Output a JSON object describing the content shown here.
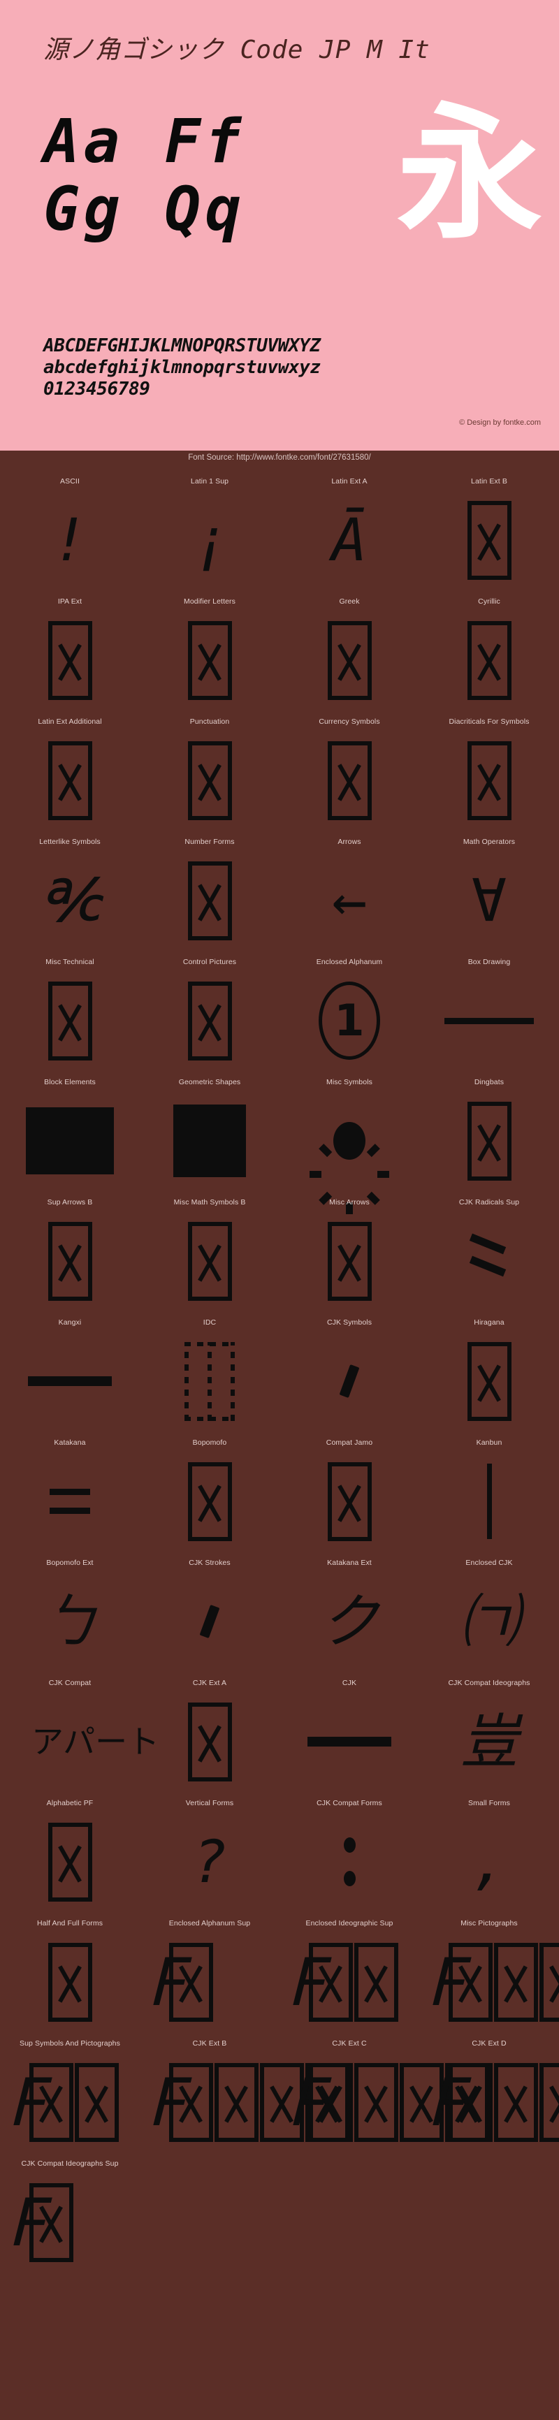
{
  "header": {
    "font_title": "源ノ角ゴシック Code JP M It",
    "sample_line_1": "Aa  Ff",
    "sample_line_2": "Gg  Qq",
    "cjk_hero": "永",
    "uppercase": "ABCDEFGHIJKLMNOPQRSTUVWXYZ",
    "lowercase": "abcdefghijklmnopqrstuvwxyz",
    "digits": "0123456789",
    "credit": "© Design by fontke.com",
    "bg_color": "#F7AEB8",
    "title_color": "#4A2420"
  },
  "source_bar": {
    "text": "Font Source: http://www.fontke.com/font/27631580/",
    "bg_color": "#5B2E27",
    "text_color": "#D9C3C0"
  },
  "grid": {
    "label_color": "#E3CFCC",
    "glyph_color": "#0D0D0D",
    "columns": 4,
    "blocks": [
      {
        "label": "ASCII",
        "glyph": "!",
        "kind": "char"
      },
      {
        "label": "Latin 1 Sup",
        "glyph": "¡",
        "kind": "char"
      },
      {
        "label": "Latin Ext A",
        "glyph": "Ā",
        "kind": "char"
      },
      {
        "label": "Latin Ext B",
        "glyph": "",
        "kind": "tofu"
      },
      {
        "label": "IPA Ext",
        "glyph": "",
        "kind": "tofu"
      },
      {
        "label": "Modifier Letters",
        "glyph": "",
        "kind": "tofu"
      },
      {
        "label": "Greek",
        "glyph": "",
        "kind": "tofu"
      },
      {
        "label": "Cyrillic",
        "glyph": "",
        "kind": "tofu"
      },
      {
        "label": "Latin Ext Additional",
        "glyph": "",
        "kind": "tofu"
      },
      {
        "label": "Punctuation",
        "glyph": "",
        "kind": "tofu"
      },
      {
        "label": "Currency Symbols",
        "glyph": "",
        "kind": "tofu"
      },
      {
        "label": "Diacriticals For Symbols",
        "glyph": "",
        "kind": "tofu"
      },
      {
        "label": "Letterlike Symbols",
        "glyph": "℀",
        "kind": "char"
      },
      {
        "label": "Number Forms",
        "glyph": "",
        "kind": "tofu"
      },
      {
        "label": "Arrows",
        "glyph": "←",
        "kind": "char"
      },
      {
        "label": "Math Operators",
        "glyph": "∀",
        "kind": "char"
      },
      {
        "label": "Misc Technical",
        "glyph": "",
        "kind": "tofu"
      },
      {
        "label": "Control Pictures",
        "glyph": "",
        "kind": "tofu"
      },
      {
        "label": "Enclosed Alphanum",
        "glyph": "1",
        "kind": "circled"
      },
      {
        "label": "Box Drawing",
        "glyph": "─",
        "kind": "bar-h"
      },
      {
        "label": "Block Elements",
        "glyph": "█",
        "kind": "block-wide"
      },
      {
        "label": "Geometric Shapes",
        "glyph": "■",
        "kind": "block-square"
      },
      {
        "label": "Misc Symbols",
        "glyph": "☀",
        "kind": "sun"
      },
      {
        "label": "Dingbats",
        "glyph": "",
        "kind": "tofu"
      },
      {
        "label": "Sup Arrows B",
        "glyph": "",
        "kind": "tofu"
      },
      {
        "label": "Misc Math Symbols B",
        "glyph": "",
        "kind": "tofu"
      },
      {
        "label": "Misc Arrows",
        "glyph": "",
        "kind": "tofu"
      },
      {
        "label": "CJK Radicals Sup",
        "glyph": "⺀",
        "kind": "two-strokes"
      },
      {
        "label": "Kangxi",
        "glyph": "⼀",
        "kind": "bar-h2"
      },
      {
        "label": "IDC",
        "glyph": "⿰",
        "kind": "tofu-dashed"
      },
      {
        "label": "CJK Symbols",
        "glyph": "、",
        "kind": "dot-stroke"
      },
      {
        "label": "Hiragana",
        "glyph": "",
        "kind": "tofu"
      },
      {
        "label": "Katakana",
        "glyph": "゠",
        "kind": "double-bar"
      },
      {
        "label": "Bopomofo",
        "glyph": "",
        "kind": "tofu"
      },
      {
        "label": "Compat Jamo",
        "glyph": "",
        "kind": "tofu"
      },
      {
        "label": "Kanbun",
        "glyph": "㆐",
        "kind": "bar-v"
      },
      {
        "label": "Bopomofo Ext",
        "glyph": "ㄅ",
        "kind": "char"
      },
      {
        "label": "CJK Strokes",
        "glyph": "㇐",
        "kind": "dot-stroke"
      },
      {
        "label": "Katakana Ext",
        "glyph": "ク",
        "kind": "char"
      },
      {
        "label": "Enclosed CJK",
        "glyph": "㈀",
        "kind": "char"
      },
      {
        "label": "CJK Compat",
        "glyph": "アパート",
        "kind": "stack"
      },
      {
        "label": "CJK Ext A",
        "glyph": "",
        "kind": "tofu"
      },
      {
        "label": "CJK",
        "glyph": "一",
        "kind": "bar-h2"
      },
      {
        "label": "CJK Compat Ideographs",
        "glyph": "豈",
        "kind": "char"
      },
      {
        "label": "Alphabetic PF",
        "glyph": "",
        "kind": "tofu"
      },
      {
        "label": "Vertical Forms",
        "glyph": "?",
        "kind": "char"
      },
      {
        "label": "CJK Compat Forms",
        "glyph": "︰",
        "kind": "double-colon"
      },
      {
        "label": "Small Forms",
        "glyph": ",",
        "kind": "char"
      },
      {
        "label": "Half And Full Forms",
        "glyph": "",
        "kind": "tofu"
      },
      {
        "label": "Enclosed Alphanum Sup",
        "glyph": "𝈓",
        "kind": "overflow-1"
      },
      {
        "label": "Enclosed Ideographic Sup",
        "glyph": "𝈓",
        "kind": "overflow-2"
      },
      {
        "label": "Misc Pictographs",
        "glyph": "𝈓",
        "kind": "overflow-3"
      },
      {
        "label": "Sup Symbols And Pictographs",
        "glyph": "𝈓",
        "kind": "overflow-2"
      },
      {
        "label": "CJK Ext B",
        "glyph": "𝈓",
        "kind": "overflow-3"
      },
      {
        "label": "CJK Ext C",
        "glyph": "𝈓",
        "kind": "overflow-3"
      },
      {
        "label": "CJK Ext D",
        "glyph": "𝈓",
        "kind": "overflow-3"
      },
      {
        "label": "CJK Compat Ideographs Sup",
        "glyph": "𝈓",
        "kind": "overflow-last"
      }
    ]
  }
}
